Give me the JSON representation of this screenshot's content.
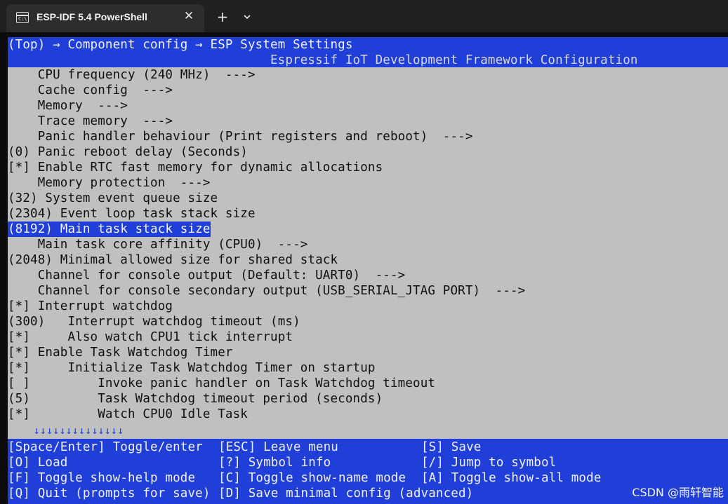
{
  "window": {
    "tab_title": "ESP-IDF 5.4 PowerShell",
    "tab_icon": "terminal-icon",
    "close_glyph": "✕",
    "new_tab_glyph": "+"
  },
  "breadcrumb": "(Top) → Component config → ESP System Settings",
  "header": "Espressif IoT Development Framework Configuration",
  "menu_items": [
    "    CPU frequency (240 MHz)  --->",
    "    Cache config  --->",
    "    Memory  --->",
    "    Trace memory  --->",
    "    Panic handler behaviour (Print registers and reboot)  --->",
    "(0) Panic reboot delay (Seconds)",
    "[*] Enable RTC fast memory for dynamic allocations",
    "    Memory protection  --->",
    "(32) System event queue size",
    "(2304) Event loop task stack size",
    "(8192) Main task stack size",
    "    Main task core affinity (CPU0)  --->",
    "(2048) Minimal allowed size for shared stack",
    "    Channel for console output (Default: UART0)  --->",
    "    Channel for console secondary output (USB_SERIAL_JTAG PORT)  --->",
    "[*] Interrupt watchdog",
    "(300)   Interrupt watchdog timeout (ms)",
    "[*]     Also watch CPU1 tick interrupt",
    "[*] Enable Task Watchdog Timer",
    "[*]     Initialize Task Watchdog Timer on startup",
    "[ ]         Invoke panic handler on Task Watchdog timeout",
    "(5)         Task Watchdog timeout period (seconds)",
    "[*]         Watch CPU0 Idle Task"
  ],
  "selected_index": 10,
  "scroll_indicator": "    ↓↓↓↓↓↓↓↓↓↓↓↓↓↓",
  "help": {
    "col1": [
      "[Space/Enter] Toggle/enter",
      "[O] Load",
      "[F] Toggle show-help mode",
      "[Q] Quit (prompts for save)"
    ],
    "col2": [
      "[ESC] Leave menu",
      "[?] Symbol info",
      "[C] Toggle show-name mode",
      "[D] Save minimal config (advanced)"
    ],
    "col3": [
      "[S] Save",
      "[/] Jump to symbol",
      "[A] Toggle show-all mode",
      ""
    ]
  },
  "watermark": "CSDN @雨轩智能",
  "colors": {
    "accent_blue": "#1f3fd8",
    "menu_bg": "#c0c0c0",
    "terminal_bg": "#0c0c0c"
  }
}
